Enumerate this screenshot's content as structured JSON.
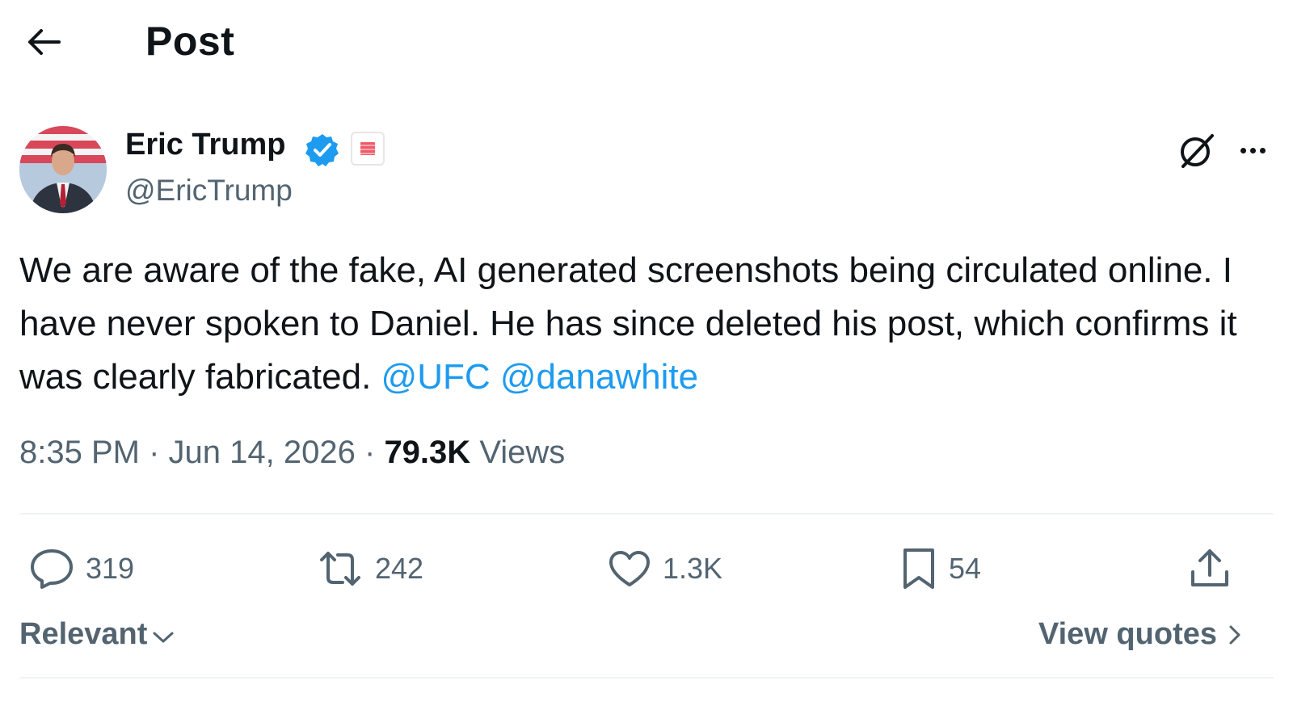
{
  "header": {
    "title": "Post",
    "back_icon": "arrow-left-icon"
  },
  "author": {
    "name": "Eric Trump",
    "handle": "@EricTrump",
    "verified": true,
    "verified_color": "#1d9bf0",
    "badge_icon": "us-flag-icon"
  },
  "post": {
    "text_before": "We are aware of the fake, AI generated screenshots being circulated online. I have never spoken to Daniel. He has since deleted his post, which confirms it was clearly fabricated.",
    "mentions": [
      "@UFC",
      "@danawhite"
    ],
    "mention_color": "#1d9bf0",
    "time": "8:35 PM",
    "date": "Jun 14, 2026",
    "views_count": "79.3K",
    "views_label": "Views",
    "separator": "·"
  },
  "actions": {
    "replies": "319",
    "reposts": "242",
    "likes": "1.3K",
    "bookmarks": "54"
  },
  "footer": {
    "sort_label": "Relevant",
    "view_quotes_label": "View quotes"
  }
}
